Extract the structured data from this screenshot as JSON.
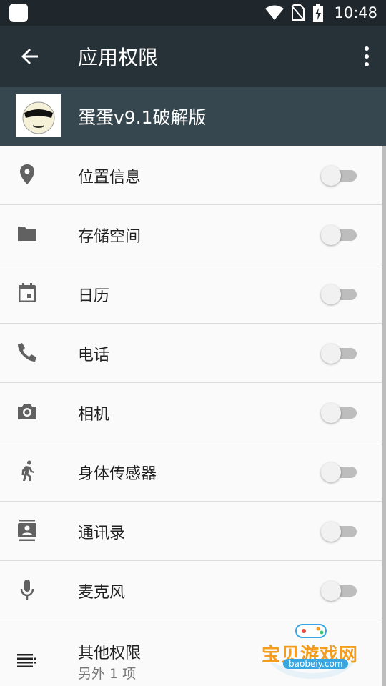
{
  "status_bar": {
    "time": "10:48",
    "icons": [
      "app-notification-icon",
      "wifi-icon",
      "no-sim-icon",
      "battery-charging-icon"
    ]
  },
  "toolbar": {
    "title": "应用权限",
    "back_icon": "arrow-back-icon",
    "menu_icon": "more-vert-icon"
  },
  "app": {
    "name": "蛋蛋v9.1破解版",
    "icon": "egg-character-logo"
  },
  "permissions": [
    {
      "label": "位置信息",
      "icon": "location-icon",
      "enabled": false
    },
    {
      "label": "存储空间",
      "icon": "folder-icon",
      "enabled": false
    },
    {
      "label": "日历",
      "icon": "calendar-icon",
      "enabled": false
    },
    {
      "label": "电话",
      "icon": "phone-icon",
      "enabled": false
    },
    {
      "label": "相机",
      "icon": "camera-icon",
      "enabled": false
    },
    {
      "label": "身体传感器",
      "icon": "walking-person-icon",
      "enabled": false
    },
    {
      "label": "通讯录",
      "icon": "contacts-icon",
      "enabled": false
    },
    {
      "label": "麦克风",
      "icon": "microphone-icon",
      "enabled": false
    }
  ],
  "other_permissions": {
    "label": "其他权限",
    "sublabel": "另外 1 项",
    "icon": "list-icon"
  },
  "watermark": {
    "title": "宝贝游戏网",
    "url": "baobeiy.com"
  },
  "colors": {
    "status_bar": "#1f272c",
    "toolbar": "#263238",
    "app_header": "#37474f",
    "list_background": "#fafafa",
    "toggle_off_track": "#bdbdbd"
  }
}
